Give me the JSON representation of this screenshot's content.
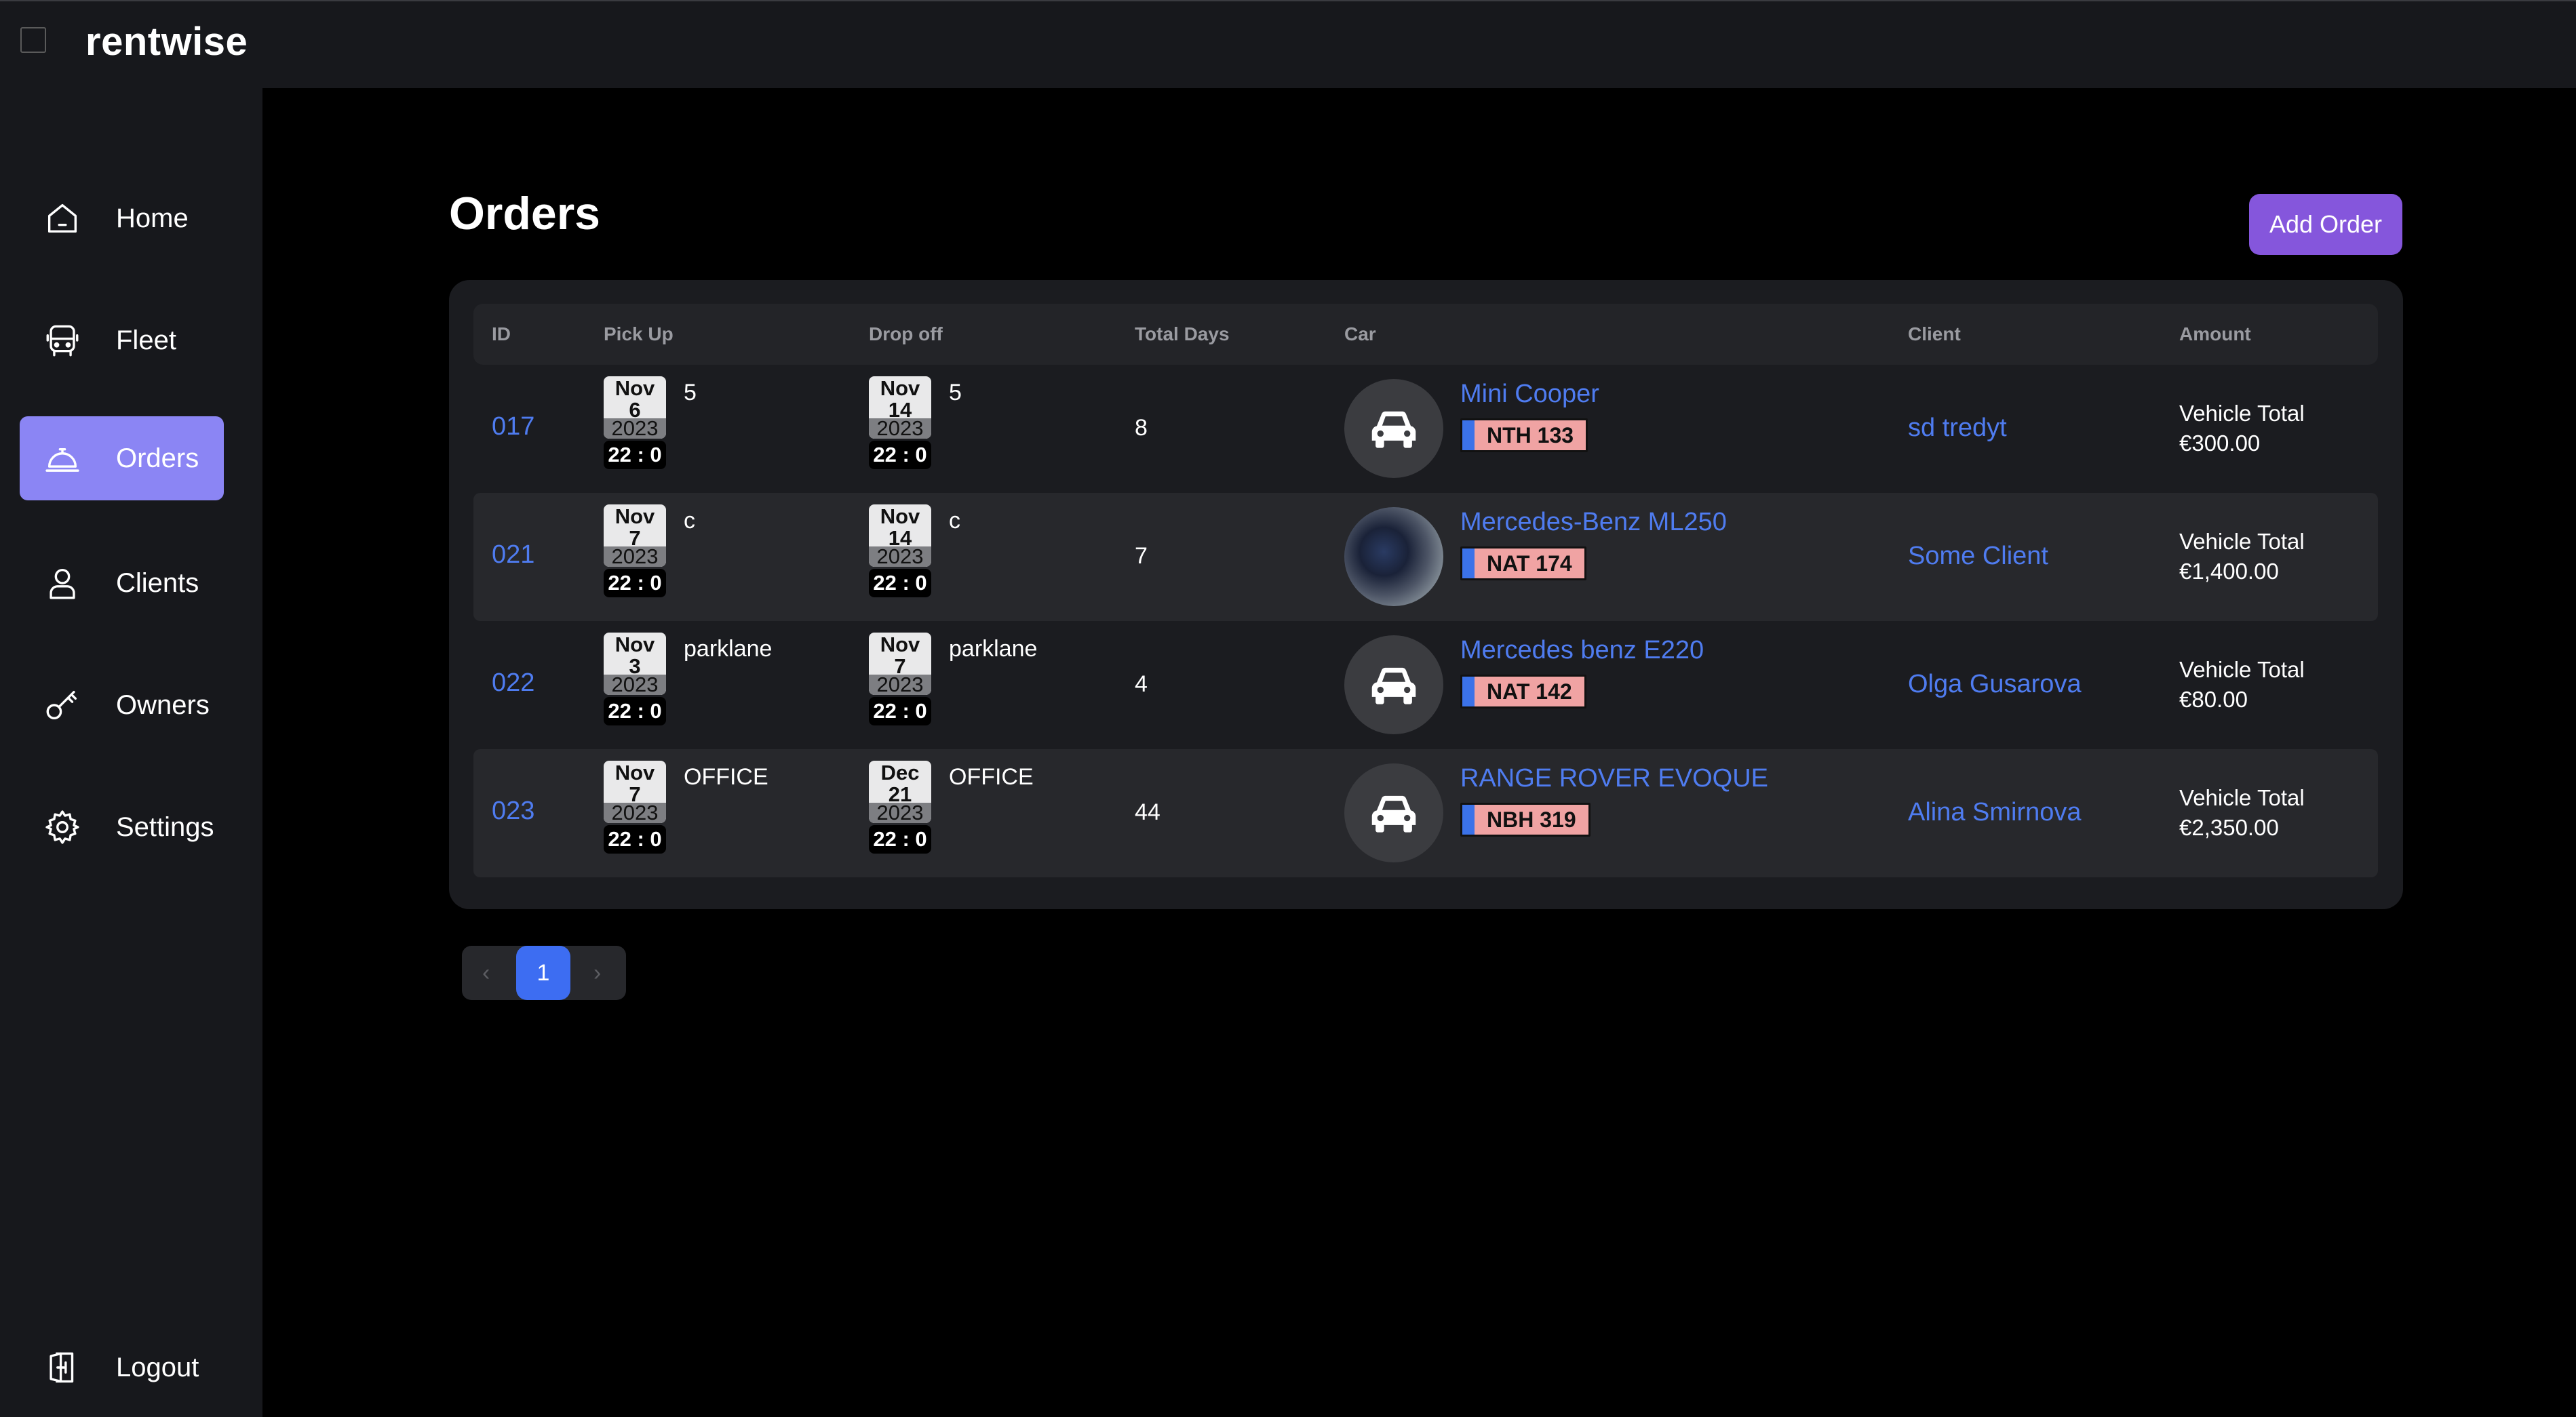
{
  "app": {
    "brand": "rentwise"
  },
  "sidebar": {
    "items": [
      {
        "label": "Home",
        "icon": "home-icon"
      },
      {
        "label": "Fleet",
        "icon": "bus-icon"
      },
      {
        "label": "Orders",
        "icon": "service-bell-icon",
        "active": true
      },
      {
        "label": "Clients",
        "icon": "user-icon"
      },
      {
        "label": "Owners",
        "icon": "key-icon"
      },
      {
        "label": "Settings",
        "icon": "gear-icon"
      }
    ],
    "logout": {
      "label": "Logout",
      "icon": "logout-icon"
    }
  },
  "page": {
    "title": "Orders",
    "add_button": "Add Order"
  },
  "table": {
    "headers": [
      "ID",
      "Pick Up",
      "Drop off",
      "Total Days",
      "Car",
      "Client",
      "Amount"
    ],
    "rows": [
      {
        "id": "017",
        "pickup": {
          "month": "Nov",
          "day": "6",
          "year": "2023",
          "time": "22 : 0",
          "location": "5"
        },
        "dropoff": {
          "month": "Nov",
          "day": "14",
          "year": "2023",
          "time": "22 : 0",
          "location": "5"
        },
        "days": "8",
        "car": {
          "name": "Mini Cooper",
          "plate": "NTH 133",
          "image": "car-icon"
        },
        "client": "sd tredyt",
        "amount": {
          "label": "Vehicle Total",
          "value": "€300.00"
        }
      },
      {
        "id": "021",
        "pickup": {
          "month": "Nov",
          "day": "7",
          "year": "2023",
          "time": "22 : 0",
          "location": "c"
        },
        "dropoff": {
          "month": "Nov",
          "day": "14",
          "year": "2023",
          "time": "22 : 0",
          "location": "c"
        },
        "days": "7",
        "car": {
          "name": "Mercedes-Benz ML250",
          "plate": "NAT 174",
          "image": "car-photo"
        },
        "client": "Some Client",
        "amount": {
          "label": "Vehicle Total",
          "value": "€1,400.00"
        }
      },
      {
        "id": "022",
        "pickup": {
          "month": "Nov",
          "day": "3",
          "year": "2023",
          "time": "22 : 0",
          "location": "parklane"
        },
        "dropoff": {
          "month": "Nov",
          "day": "7",
          "year": "2023",
          "time": "22 : 0",
          "location": "parklane"
        },
        "days": "4",
        "car": {
          "name": "Mercedes benz E220",
          "plate": "NAT 142",
          "image": "car-icon"
        },
        "client": "Olga Gusarova",
        "amount": {
          "label": "Vehicle Total",
          "value": "€80.00"
        }
      },
      {
        "id": "023",
        "pickup": {
          "month": "Nov",
          "day": "7",
          "year": "2023",
          "time": "22 : 0",
          "location": "OFFICE"
        },
        "dropoff": {
          "month": "Dec",
          "day": "21",
          "year": "2023",
          "time": "22 : 0",
          "location": "OFFICE"
        },
        "days": "44",
        "car": {
          "name": "RANGE ROVER EVOQUE",
          "plate": "NBH 319",
          "image": "car-icon"
        },
        "client": "Alina Smirnova",
        "amount": {
          "label": "Vehicle Total",
          "value": "€2,350.00"
        }
      }
    ]
  },
  "pagination": {
    "current": "1",
    "prev": "‹",
    "next": "›"
  },
  "colors": {
    "accent": "#8b85f4",
    "button": "#8556dc",
    "link": "#4f7cf0",
    "plate": "#f0a3a3"
  }
}
